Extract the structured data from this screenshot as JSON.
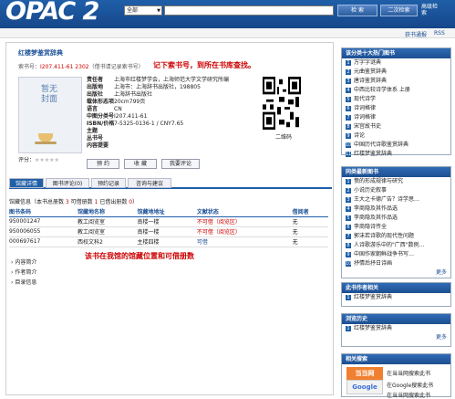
{
  "header": {
    "logo": "OPAC 2",
    "select_value": "全部",
    "search_btn": "检 索",
    "second_btn": "二次检索",
    "adv": "高级检索"
  },
  "subbar": {
    "left": "",
    "right1": "获书通报",
    "right2": "RSS"
  },
  "book": {
    "title": "红楼梦鉴赏辞典",
    "callno_label": "索书号：",
    "callno": "I207.411-61 2302",
    "callno_note": "（借书请记录索书号）",
    "annotation1": "记下索书号，到所在书库查找。",
    "cover_text": "暂无封面",
    "rating_label": "评分：",
    "stars": "★★★★★",
    "fields": [
      [
        "责任者",
        "上海市红楼梦学会，上海师范大学文学研究所编"
      ],
      [
        "出版地",
        "上海市：上海辞书出版社，198805"
      ],
      [
        "出版社",
        "上海辞书出版社"
      ],
      [
        "载体形态项",
        "20cm799页"
      ],
      [
        "语言",
        "CN"
      ],
      [
        "中图分类号",
        "I207.411-61"
      ],
      [
        "ISBN/价格",
        "7-5325-0136-1 / CNY7.65"
      ],
      [
        "主题",
        ""
      ],
      [
        "丛书号",
        ""
      ],
      [
        "内容提要",
        ""
      ]
    ],
    "qr_label": "二维码",
    "actions": [
      "预 约",
      "收 藏",
      "我要评论"
    ]
  },
  "tabs": [
    "馆藏详情",
    "图书评论(0)",
    "预约记录",
    "咨询与建议"
  ],
  "holdings": {
    "summary_a": "馆藏信息（本书总册数 ",
    "total": "3",
    "summary_b": " 可借册数 ",
    "avail": "1",
    "summary_c": " 已借出册数 ",
    "out": "0",
    "summary_d": "）",
    "headers": [
      "图书条码",
      "馆藏地名称",
      "馆藏地地址",
      "文献状态",
      "借阅者"
    ],
    "rows": [
      [
        "950001247",
        "教工阅览室",
        "南楼一楼",
        "不可借（阅览区）",
        "无"
      ],
      [
        "950006055",
        "教工阅览室",
        "南楼一楼",
        "不可借（阅览区）",
        "无"
      ],
      [
        "000697617",
        "西校文科2",
        "主楼四楼",
        "可借",
        "无"
      ]
    ],
    "annotation2": "该书在我馆的馆藏位置和可借册数"
  },
  "tree": [
    "内容简介",
    "作者简介",
    "目录信息"
  ],
  "sidebar": {
    "box1": {
      "title": "该分类十大热门图书",
      "items": [
        "万字字谜典",
        "元曲鉴赏辞典",
        "唐诗鉴赏辞典",
        "中西比较诗学体系 上册",
        "现代诗学",
        "诗词格律",
        "诗词格律",
        "宋宫故书史",
        "诗论",
        "中国历代诗歌鉴赏辞典",
        "红楼梦鉴赏辞典"
      ]
    },
    "box2": {
      "title": "同类最新图书",
      "items": [
        "愤的形成规律与研究",
        "小说历史叙事",
        "王大之卡德广告？诗学思…",
        "李商隐及其作品选",
        "李商隐及其作品选",
        "李商隐诗传全",
        "郭沫若诗歌的现代性问题",
        "人诗歌游乐中的\"广西\"数例…",
        "中国作家朝鲜战争书写…",
        "抒情后抒日诗画"
      ],
      "more": "更多"
    },
    "box3": {
      "title": "此书作者相关",
      "items": [
        "红楼梦鉴赏辞典"
      ]
    },
    "box4": {
      "title": "浏览历史",
      "items": [
        "红楼梦鉴赏辞典"
      ],
      "more": "更多"
    },
    "box5": {
      "title": "相关搜索",
      "ad1": "当当网",
      "ad2": "Google",
      "t1": "在当当网搜索此书",
      "t2": "在Google搜索此书",
      "t3": "在当当网搜索此书"
    }
  }
}
